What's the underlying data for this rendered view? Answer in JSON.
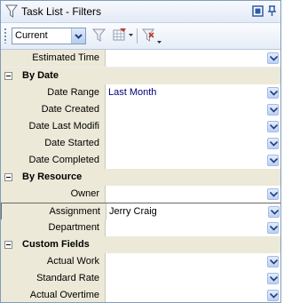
{
  "window": {
    "title": "Task List - Filters"
  },
  "toolbar": {
    "filter_select_value": "Current"
  },
  "grid": {
    "top_row": {
      "label": "Estimated Time",
      "value": ""
    },
    "categories": [
      {
        "title": "By Date",
        "rows": [
          {
            "label": "Date Range",
            "value": "Last Month"
          },
          {
            "label": "Date Created",
            "value": ""
          },
          {
            "label": "Date Last Modifi",
            "value": ""
          },
          {
            "label": "Date Started",
            "value": ""
          },
          {
            "label": "Date Completed",
            "value": ""
          }
        ]
      },
      {
        "title": "By Resource",
        "rows": [
          {
            "label": "Owner",
            "value": ""
          },
          {
            "label": "Assignment",
            "value": "Jerry Craig"
          },
          {
            "label": "Department",
            "value": ""
          }
        ]
      },
      {
        "title": "Custom Fields",
        "rows": [
          {
            "label": "Actual Work",
            "value": ""
          },
          {
            "label": "Standard Rate",
            "value": ""
          },
          {
            "label": "Actual Overtime",
            "value": ""
          }
        ]
      }
    ]
  },
  "icons": {
    "title": "filter-icon",
    "title_buttons": [
      "window-toggle-icon",
      "pin-icon"
    ],
    "toolbar": [
      "filter-funnel-icon",
      "filter-dropdown-icon",
      "clear-filter-icon"
    ]
  },
  "colors": {
    "value_text": "#00007c",
    "label_background": "#ece9d8",
    "border": "#7f9db9"
  }
}
